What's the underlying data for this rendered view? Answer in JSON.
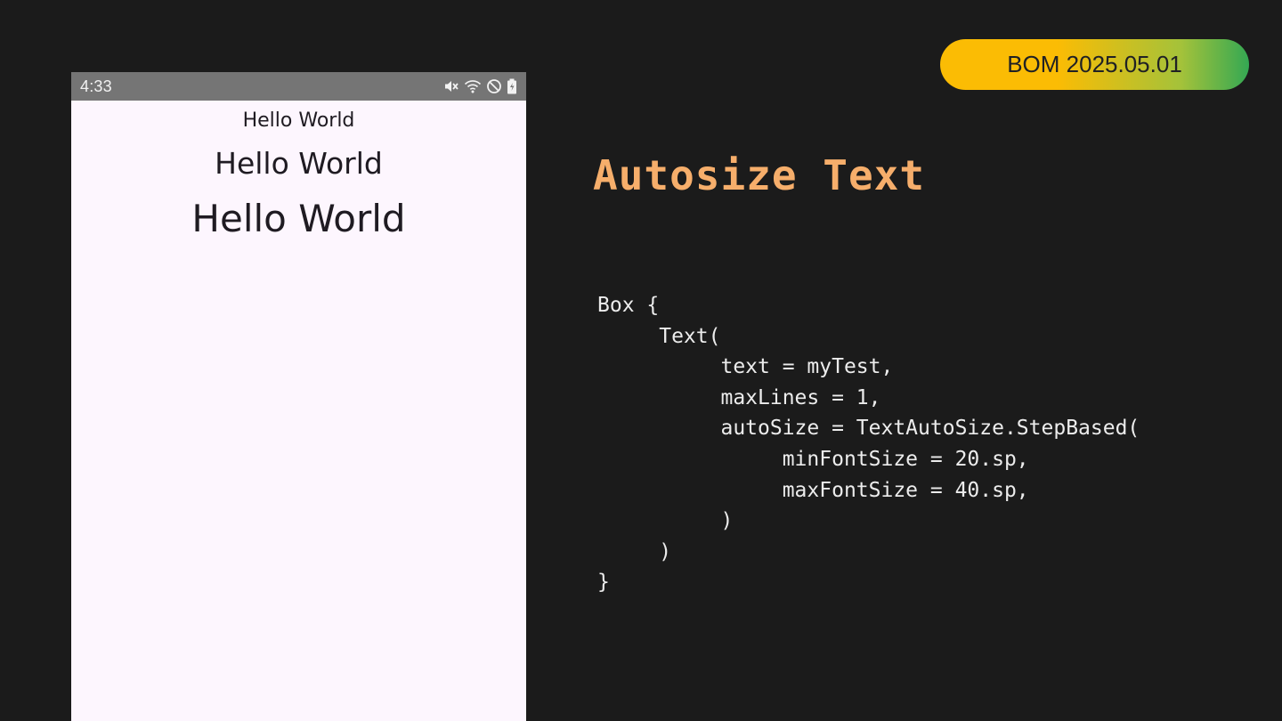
{
  "status_bar": {
    "time": "4:33",
    "icons": [
      "mute-icon",
      "wifi-icon",
      "do-not-disturb-icon",
      "battery-charging-icon"
    ]
  },
  "phone": {
    "texts": [
      "Hello World",
      "Hello World",
      "Hello World"
    ]
  },
  "badge": {
    "label": "BOM 2025.05.01",
    "colors": [
      "#fbbc04",
      "#34a853"
    ]
  },
  "title": {
    "text": "Autosize Text",
    "color": "#f6ae6b"
  },
  "code": {
    "lines": [
      "Box {",
      "     Text(",
      "          text = myTest,",
      "          maxLines = 1,",
      "          autoSize = TextAutoSize.StepBased(",
      "               minFontSize = 20.sp,",
      "               maxFontSize = 40.sp,",
      "          )",
      "     )",
      "}"
    ]
  }
}
